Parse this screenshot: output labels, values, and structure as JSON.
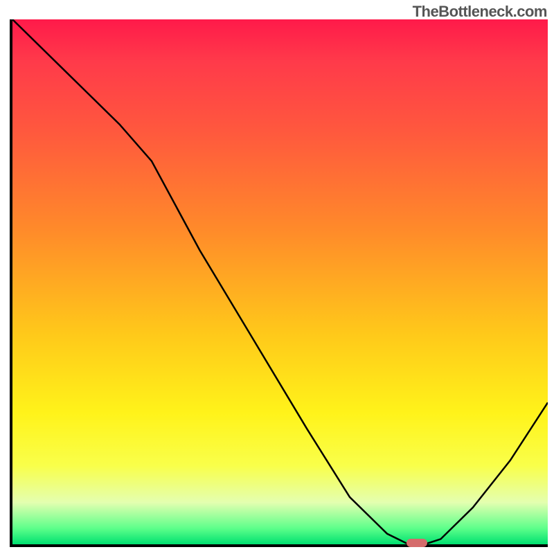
{
  "watermark": "TheBottleneck.com",
  "chart_data": {
    "type": "line",
    "title": "",
    "xlabel": "",
    "ylabel": "",
    "xlim": [
      0,
      100
    ],
    "ylim": [
      0,
      100
    ],
    "series": [
      {
        "name": "bottleneck-curve",
        "x": [
          0,
          10,
          20,
          26,
          35,
          45,
          55,
          63,
          70,
          74,
          77,
          80,
          86,
          93,
          100
        ],
        "values": [
          100,
          90,
          80,
          73,
          56,
          39,
          22,
          9,
          2,
          0,
          0,
          1,
          7,
          16,
          27
        ]
      }
    ],
    "marker": {
      "x": 75.5,
      "y": 0.3
    },
    "gradient_stops": [
      {
        "pos": 0,
        "color": "#ff1a4a"
      },
      {
        "pos": 22,
        "color": "#ff5a3d"
      },
      {
        "pos": 60,
        "color": "#ffc91a"
      },
      {
        "pos": 85,
        "color": "#f9ff4a"
      },
      {
        "pos": 100,
        "color": "#00e070"
      }
    ]
  }
}
